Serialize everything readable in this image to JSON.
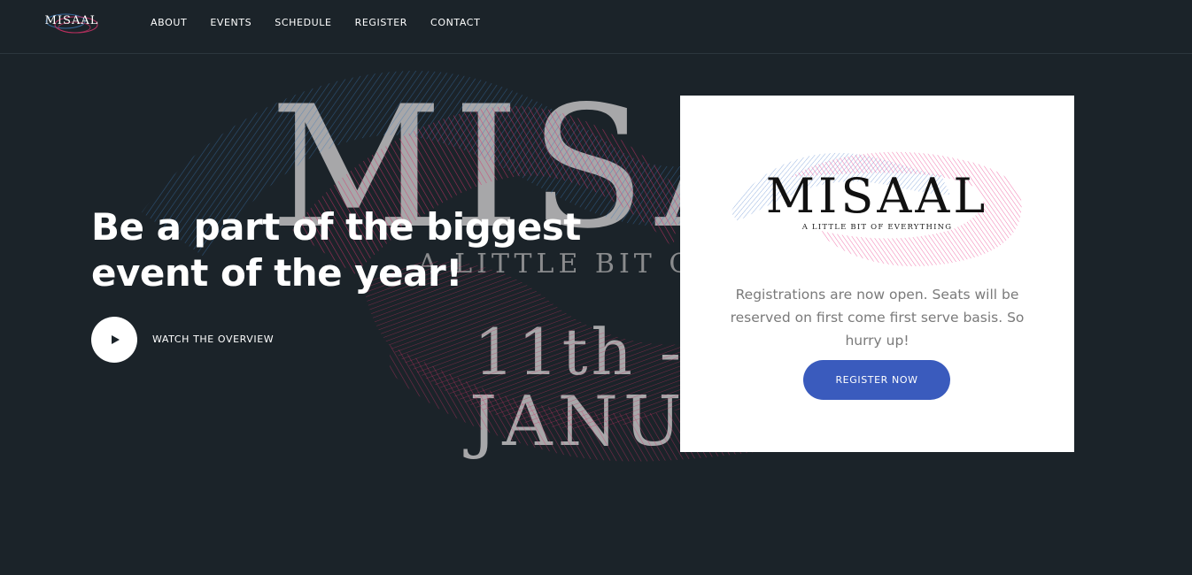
{
  "header": {
    "logo_text": "MISAAL",
    "nav": [
      {
        "label": "ABOUT"
      },
      {
        "label": "EVENTS"
      },
      {
        "label": "SCHEDULE"
      },
      {
        "label": "REGISTER"
      },
      {
        "label": "CONTACT"
      }
    ]
  },
  "hero": {
    "background_word": "MISAAL",
    "background_tagline": "A LITTLE BIT OF E",
    "background_date": "11th -",
    "background_month": "JANUARY",
    "title_line1": "Be a part of the biggest",
    "title_line2": "event of the year!",
    "watch_label": "WATCH THE OVERVIEW"
  },
  "card": {
    "logo_title": "MISAAL",
    "logo_tagline": "A LITTLE BIT OF EVERYTHING",
    "text": "Registrations are now open. Seats will be reserved on first come first serve basis. So hurry up!",
    "button_label": "REGISTER NOW"
  },
  "colors": {
    "background": "#1b2329",
    "accent_blue": "#3a5bbd",
    "wave_pink": "#d6336c",
    "wave_blue": "#3b78b5"
  }
}
